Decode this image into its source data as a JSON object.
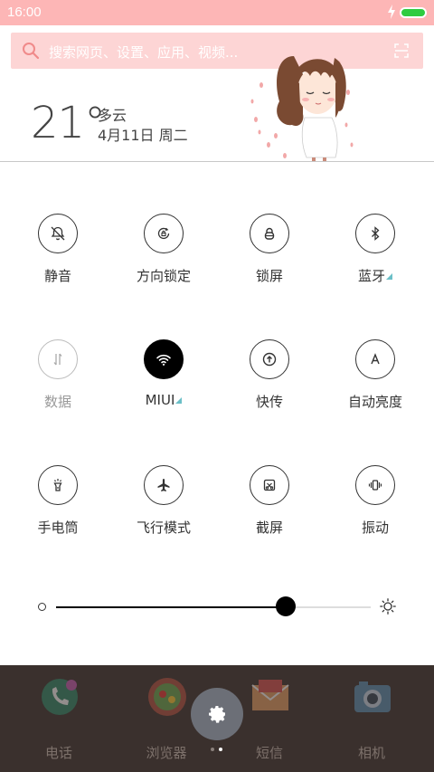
{
  "status_bar": {
    "time": "16:00",
    "battery_color": "#2ecc40"
  },
  "search": {
    "placeholder": "搜索网页、设置、应用、视频..."
  },
  "weather": {
    "temperature": "21°",
    "condition": "多云",
    "date": "4月11日 周二"
  },
  "toggles": [
    {
      "label": "静音",
      "icon": "bell-off-icon",
      "state": "off"
    },
    {
      "label": "方向锁定",
      "icon": "rotation-lock-icon",
      "state": "off"
    },
    {
      "label": "锁屏",
      "icon": "lock-icon",
      "state": "off"
    },
    {
      "label": "蓝牙",
      "icon": "bluetooth-icon",
      "state": "off",
      "expandable": true
    },
    {
      "label": "数据",
      "icon": "mobile-data-icon",
      "state": "disabled"
    },
    {
      "label": "MIUI",
      "icon": "wifi-icon",
      "state": "on",
      "expandable": true
    },
    {
      "label": "快传",
      "icon": "share-upload-icon",
      "state": "off"
    },
    {
      "label": "自动亮度",
      "icon": "auto-brightness-icon",
      "state": "off"
    },
    {
      "label": "手电筒",
      "icon": "flashlight-icon",
      "state": "off"
    },
    {
      "label": "飞行模式",
      "icon": "airplane-icon",
      "state": "off"
    },
    {
      "label": "截屏",
      "icon": "screenshot-icon",
      "state": "off"
    },
    {
      "label": "振动",
      "icon": "vibrate-icon",
      "state": "off"
    }
  ],
  "brightness": {
    "level": 0.73
  },
  "dock": {
    "apps": [
      {
        "label": "电话",
        "icon": "phone-icon"
      },
      {
        "label": "浏览器",
        "icon": "browser-icon"
      },
      {
        "label": "短信",
        "icon": "messages-icon"
      },
      {
        "label": "相机",
        "icon": "camera-icon"
      }
    ],
    "page_count": 2,
    "current_page": 2
  },
  "colors": {
    "accent": "#fdb6b6",
    "expand_marker": "#6bbfc7",
    "dock_bg": "#3a302d"
  }
}
